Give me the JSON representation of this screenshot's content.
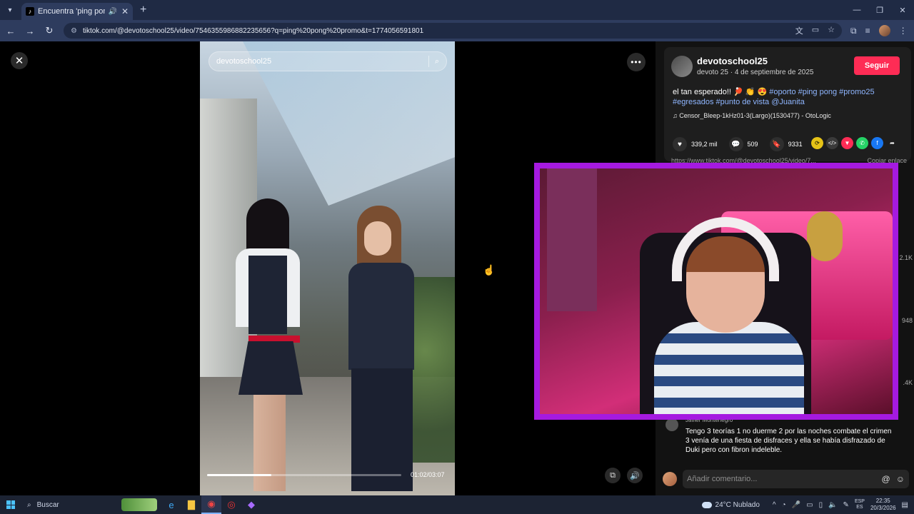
{
  "browser": {
    "tab_title": "Encuentra 'ping pong prom",
    "url": "tiktok.com/@devotoschool25/video/7546355986882235656?q=ping%20pong%20promo&t=1774056591801"
  },
  "video": {
    "search_placeholder": "devotoschool25",
    "timecode": "01:02/03:07",
    "progress": 0.33
  },
  "post": {
    "username": "devotoschool25",
    "subtitle": "devoto 25 · 4 de septiembre de 2025",
    "follow_label": "Seguir",
    "caption_text": "el tan esperado!! 🏓 👏 😍 ",
    "caption_tags_1": "#oporto #ping pong #promo25",
    "caption_tags_2": "#egresados #punto de vista @Juanita",
    "music": "♫  Censor_Bleep-1kHz01-3(Largo)(1530477) - OtoLogic",
    "likes": "339,2 mil",
    "comments": "509",
    "saves": "9331",
    "link_url": "https://www.tiktok.com/@devotoschool25/video/7...",
    "copy_link_label": "Copiar enlace",
    "side_counts": [
      "2.1K",
      "948",
      ".4K"
    ]
  },
  "comment": {
    "author": "Javier Montenegro",
    "text": "Tengo 3 teorías 1 no duerme 2 por las noches combate el crimen 3 venía de una fiesta de disfraces y ella se había disfrazado de Duki pero con fibron indeleble."
  },
  "composer": {
    "placeholder": "Añadir comentario..."
  },
  "taskbar": {
    "search_label": "Buscar",
    "weather": "24°C  Nublado",
    "lang_1": "ESP",
    "lang_2": "ES",
    "time": "22:35",
    "date": "20/3/2026"
  }
}
